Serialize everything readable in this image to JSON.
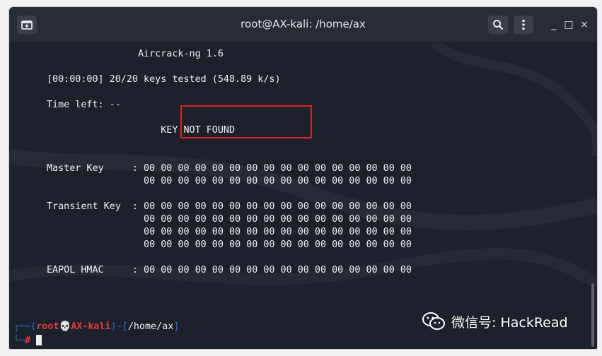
{
  "window": {
    "title": "root@AX-kali: /home/ax",
    "controls": {
      "minimize": "_",
      "maximize": "□",
      "close": "×"
    }
  },
  "terminal": {
    "lines": [
      "                Aircrack-ng 1.6",
      "[00:00:00] 20/20 keys tested (548.89 k/s)",
      "Time left: --",
      "                    KEY NOT FOUND",
      "Master Key     : 00 00 00 00 00 00 00 00 00 00 00 00 00 00 00 00",
      "                 00 00 00 00 00 00 00 00 00 00 00 00 00 00 00 00",
      "Transient Key  : 00 00 00 00 00 00 00 00 00 00 00 00 00 00 00 00",
      "                 00 00 00 00 00 00 00 00 00 00 00 00 00 00 00 00",
      "                 00 00 00 00 00 00 00 00 00 00 00 00 00 00 00 00",
      "                 00 00 00 00 00 00 00 00 00 00 00 00 00 00 00 00",
      "EAPOL HMAC     : 00 00 00 00 00 00 00 00 00 00 00 00 00 00 00 00"
    ],
    "prompt": {
      "open": "┌──(",
      "user": "root",
      "skull": "💀",
      "host": "AX-kali",
      "mid": ")-[",
      "path": "/home/ax",
      "close": "]",
      "second_line": "└─",
      "hash": "#"
    }
  },
  "watermark": {
    "text": "微信号: HackRead"
  },
  "colors": {
    "terminal_bg": "#1d212b",
    "highlight_border": "#e0201e",
    "prompt_blue": "#2f6fe0",
    "prompt_red": "#e23b3b"
  }
}
